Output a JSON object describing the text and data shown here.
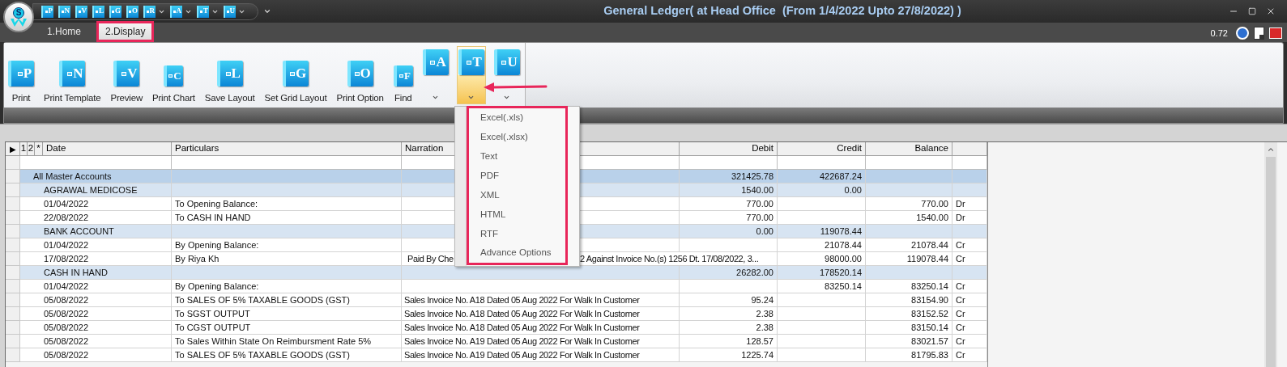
{
  "window": {
    "title": "General Ledger( at Head Office  (From 1/4/2022 Upto 27/8/2022) )",
    "logo_text": "S",
    "version": "0.72"
  },
  "quick_access": [
    {
      "letter": "P",
      "dropdown": false
    },
    {
      "letter": "N",
      "dropdown": false
    },
    {
      "letter": "V",
      "dropdown": false
    },
    {
      "letter": "L",
      "dropdown": false
    },
    {
      "letter": "G",
      "dropdown": false
    },
    {
      "letter": "O",
      "dropdown": false
    },
    {
      "letter": "R",
      "dropdown": true
    },
    {
      "letter": "A",
      "dropdown": true
    },
    {
      "letter": "T",
      "dropdown": true
    },
    {
      "letter": "U",
      "dropdown": true
    }
  ],
  "tabs": [
    {
      "label": "1.Home",
      "selected": false,
      "marked": false
    },
    {
      "label": "2.Display",
      "selected": true,
      "marked": true
    }
  ],
  "ribbon": {
    "buttons": [
      {
        "kind": "large",
        "letter": "P",
        "label": "Print"
      },
      {
        "kind": "large",
        "letter": "N",
        "label": "Print Template"
      },
      {
        "kind": "large",
        "letter": "V",
        "label": "Preview"
      },
      {
        "kind": "small",
        "letter": "C",
        "label": "Print Chart"
      },
      {
        "kind": "large",
        "letter": "L",
        "label": "Save Layout"
      },
      {
        "kind": "large",
        "letter": "G",
        "label": "Set Grid Layout"
      },
      {
        "kind": "large",
        "letter": "O",
        "label": "Print Option"
      },
      {
        "kind": "small",
        "letter": "F",
        "label": "Find"
      },
      {
        "kind": "split",
        "letter": "A",
        "open": false
      },
      {
        "kind": "split",
        "letter": "T",
        "open": true
      },
      {
        "kind": "split",
        "letter": "U",
        "open": false
      }
    ]
  },
  "export_menu": {
    "marked": true,
    "arrow": true,
    "items": [
      "Excel(.xls)",
      "Excel(.xlsx)",
      "Text",
      "PDF",
      "XML",
      "HTML",
      "RTF",
      "Advance Options"
    ]
  },
  "grid": {
    "row_header": "▶",
    "levels": [
      "1",
      "2",
      "*"
    ],
    "columns": [
      "Date",
      "Particulars",
      "Narration",
      "Debit",
      "Credit",
      "Balance"
    ],
    "rows": [
      {
        "kind": "total",
        "label": "All Master Accounts",
        "debit": "321425.78",
        "credit": "422687.24"
      },
      {
        "kind": "account",
        "label": "AGRAWAL MEDICOSE",
        "debit": "1540.00",
        "credit": "0.00"
      },
      {
        "kind": "entry",
        "date": "01/04/2022",
        "particulars": "To Opening Balance:",
        "debit": "770.00",
        "balance": "770.00",
        "side": "Dr"
      },
      {
        "kind": "entry",
        "date": "22/08/2022",
        "particulars": "To CASH IN HAND",
        "debit": "770.00",
        "balance": "1540.00",
        "side": "Dr"
      },
      {
        "kind": "account",
        "label": "BANK ACCOUNT",
        "debit": "0.00",
        "credit": "119078.44"
      },
      {
        "kind": "entry",
        "date": "01/04/2022",
        "particulars": "By Opening Balance:",
        "credit": "21078.44",
        "balance": "21078.44",
        "side": "Cr"
      },
      {
        "kind": "entry",
        "date": "17/08/2022",
        "particulars": "By Riya Kh",
        "narration": "Paid  By Che",
        "narration_tail": "2 Against Invoice No.(s) 1256 Dt. 17/08/2022, 3...",
        "credit": "98000.00",
        "balance": "119078.44",
        "side": "Cr"
      },
      {
        "kind": "account",
        "label": "CASH IN HAND",
        "debit": "26282.00",
        "credit": "178520.14"
      },
      {
        "kind": "entry",
        "date": "01/04/2022",
        "particulars": "By Opening Balance:",
        "credit": "83250.14",
        "balance": "83250.14",
        "side": "Cr"
      },
      {
        "kind": "entry",
        "date": "05/08/2022",
        "particulars": "To SALES OF 5% TAXABLE GOODS (GST)",
        "narration": "Sales Invoice No. A18 Dated 05 Aug 2022 For Walk In Customer",
        "debit": "95.24",
        "balance": "83154.90",
        "side": "Cr"
      },
      {
        "kind": "entry",
        "date": "05/08/2022",
        "particulars": "To SGST OUTPUT",
        "narration": "Sales Invoice No. A18 Dated 05 Aug 2022 For Walk In Customer",
        "debit": "2.38",
        "balance": "83152.52",
        "side": "Cr"
      },
      {
        "kind": "entry",
        "date": "05/08/2022",
        "particulars": "To CGST OUTPUT",
        "narration": "Sales Invoice No. A18 Dated 05 Aug 2022 For Walk In Customer",
        "debit": "2.38",
        "balance": "83150.14",
        "side": "Cr"
      },
      {
        "kind": "entry",
        "date": "05/08/2022",
        "particulars": "To Sales Within State On Reimbursment Rate 5%",
        "narration": "Sales Invoice No. A19 Dated 05 Aug 2022 For Walk In Customer",
        "debit": "128.57",
        "balance": "83021.57",
        "side": "Cr"
      },
      {
        "kind": "entry",
        "date": "05/08/2022",
        "particulars": "To SALES OF 5% TAXABLE GOODS (GST)",
        "narration": "Sales Invoice No. A19 Dated 05 Aug 2022 For Walk In Customer",
        "debit": "1225.74",
        "balance": "81795.83",
        "side": "Cr"
      }
    ]
  }
}
